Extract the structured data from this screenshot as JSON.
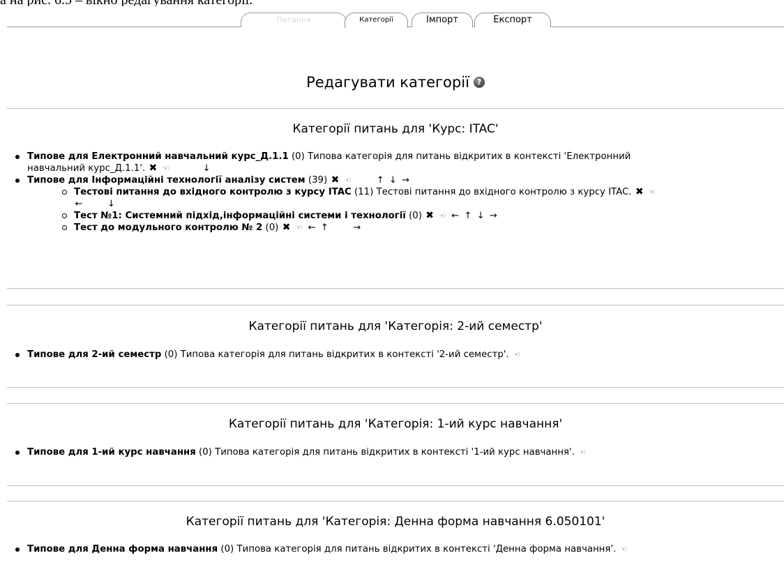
{
  "caption_cut": "а на рис. 6.5 – вікно редагування категорії.",
  "tabs": {
    "questions_label": "Питання",
    "categories_label": "Категорії",
    "import_label": "Імпорт",
    "export_label": "Експорт"
  },
  "page": {
    "title": "Редагувати категорії",
    "help_glyph": "?"
  },
  "icons": {
    "delete": "✖",
    "edit": "☜",
    "left": "←",
    "up": "↑",
    "down": "↓",
    "right": "→"
  },
  "sections": [
    {
      "heading": "Категорії питань для 'Курс: ITAC'",
      "items": [
        {
          "name": "Типове для Електронний навчальний курс_Д.1.1",
          "count": "(0)",
          "desc_line1": "Типова категорія для питань відкритих в контексті 'Електронний",
          "desc_line2": "навчальний курс_Д.1.1'."
        },
        {
          "name": "Типове для Інформаційні технології аналізу систем",
          "count": "(39)",
          "children": [
            {
              "name": "Тестові питання до вхідного контролю з курсу ITAC",
              "count": "(11)",
              "desc": "Тестові питання до вхідного контролю з курсу ITAC."
            },
            {
              "name": "Тест №1: Системний підхід,інформаційні системи і технології",
              "count": "(0)"
            },
            {
              "name": "Тест до модульного контролю № 2",
              "count": "(0)"
            }
          ]
        }
      ]
    },
    {
      "heading": "Категорії питань для 'Категорія: 2-ий семестр'",
      "items": [
        {
          "name": "Типове для 2-ий семестр",
          "count": "(0)",
          "desc": "Типова категорія для питань відкритих в контексті '2-ий семестр'."
        }
      ]
    },
    {
      "heading": "Категорії питань для 'Категорія: 1-ий курс навчання'",
      "items": [
        {
          "name": "Типове для 1-ий курс навчання",
          "count": "(0)",
          "desc": "Типова категорія для питань відкритих в контексті '1-ий курс навчання'."
        }
      ]
    },
    {
      "heading": "Категорії питань для 'Категорія: Денна форма навчання 6.050101'",
      "items": [
        {
          "name": "Типове для Денна форма навчання",
          "count": "(0)",
          "desc": "Типова категорія для питань відкритих в контексті 'Денна форма навчання'."
        }
      ]
    }
  ]
}
